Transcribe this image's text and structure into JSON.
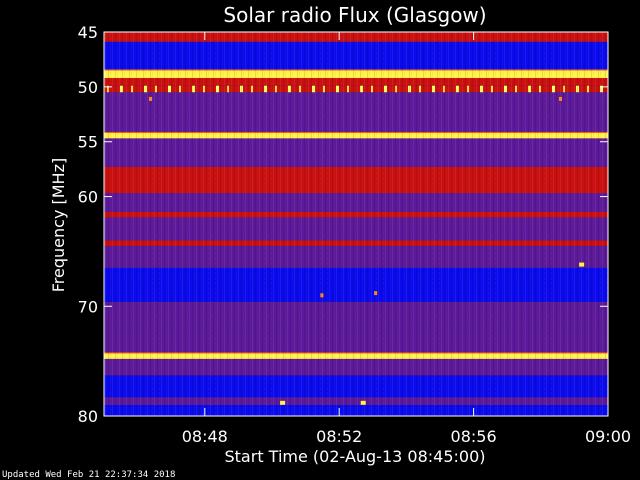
{
  "chart_data": {
    "type": "heatmap",
    "title": "Solar radio Flux (Glasgow)",
    "xlabel": "Start Time (02-Aug-13 08:45:00)",
    "ylabel": "Frequency [MHz]",
    "x_range_minutes": [
      0,
      15
    ],
    "x_ticks": [
      {
        "minute": 3,
        "label": "08:48"
      },
      {
        "minute": 7,
        "label": "08:52"
      },
      {
        "minute": 11,
        "label": "08:56"
      },
      {
        "minute": 15,
        "label": "09:00"
      }
    ],
    "ylim": [
      45,
      80
    ],
    "y_inverted": true,
    "y_ticks": [
      {
        "value": 45,
        "label": "45"
      },
      {
        "value": 50,
        "label": "50"
      },
      {
        "value": 55,
        "label": "55"
      },
      {
        "value": 60,
        "label": "60"
      },
      {
        "value": 70,
        "label": "70"
      },
      {
        "value": 80,
        "label": "80"
      }
    ],
    "colormap": [
      "#0000ff",
      "#5a1a9a",
      "#c81010",
      "#ffff40"
    ],
    "bands": [
      {
        "from": 45.0,
        "to": 45.9,
        "level": "red"
      },
      {
        "from": 45.9,
        "to": 48.5,
        "level": "blue"
      },
      {
        "from": 48.5,
        "to": 49.2,
        "level": "yellow"
      },
      {
        "from": 49.2,
        "to": 49.9,
        "level": "red"
      },
      {
        "from": 49.9,
        "to": 50.5,
        "level": "yellow-dashed"
      },
      {
        "from": 50.5,
        "to": 54.2,
        "level": "purple"
      },
      {
        "from": 54.2,
        "to": 54.7,
        "level": "yellow"
      },
      {
        "from": 54.7,
        "to": 57.3,
        "level": "purple"
      },
      {
        "from": 57.3,
        "to": 59.7,
        "level": "red"
      },
      {
        "from": 59.7,
        "to": 61.4,
        "level": "purple"
      },
      {
        "from": 61.4,
        "to": 61.9,
        "level": "red"
      },
      {
        "from": 61.9,
        "to": 64.0,
        "level": "purple"
      },
      {
        "from": 64.0,
        "to": 64.5,
        "level": "red"
      },
      {
        "from": 64.5,
        "to": 66.5,
        "level": "purple"
      },
      {
        "from": 66.5,
        "to": 69.6,
        "level": "blue"
      },
      {
        "from": 69.6,
        "to": 72.0,
        "level": "purple"
      },
      {
        "from": 72.0,
        "to": 74.3,
        "level": "purple"
      },
      {
        "from": 74.3,
        "to": 74.8,
        "level": "yellow"
      },
      {
        "from": 74.8,
        "to": 76.3,
        "level": "purple"
      },
      {
        "from": 76.3,
        "to": 78.3,
        "level": "blue"
      },
      {
        "from": 78.3,
        "to": 79.0,
        "level": "purple"
      },
      {
        "from": 79.0,
        "to": 80.0,
        "level": "blue"
      }
    ],
    "hotspots": [
      {
        "minute": 14.2,
        "freq": 66.2,
        "level": "yellow"
      },
      {
        "minute": 5.3,
        "freq": 78.8,
        "level": "yellow"
      },
      {
        "minute": 7.7,
        "freq": 78.8,
        "level": "yellow"
      },
      {
        "minute": 1.4,
        "freq": 51.1,
        "level": "orange"
      },
      {
        "minute": 13.6,
        "freq": 51.1,
        "level": "orange"
      },
      {
        "minute": 8.1,
        "freq": 68.8,
        "level": "orange"
      },
      {
        "minute": 6.5,
        "freq": 69.0,
        "level": "orange"
      }
    ]
  },
  "footer": {
    "updated": "Updated Wed Feb 21 22:37:34 2018"
  }
}
